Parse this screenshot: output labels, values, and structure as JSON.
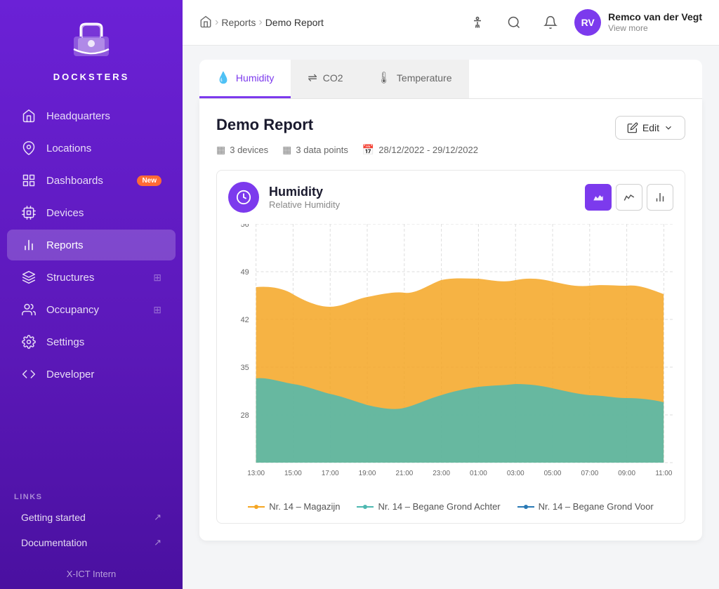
{
  "app": {
    "name": "DOCKSTERS",
    "footer": "X-ICT Intern"
  },
  "sidebar": {
    "nav_items": [
      {
        "id": "headquarters",
        "label": "Headquarters",
        "icon": "home"
      },
      {
        "id": "locations",
        "label": "Locations",
        "icon": "map-pin"
      },
      {
        "id": "dashboards",
        "label": "Dashboards",
        "icon": "grid",
        "badge": "New"
      },
      {
        "id": "devices",
        "label": "Devices",
        "icon": "cpu"
      },
      {
        "id": "reports",
        "label": "Reports",
        "icon": "bar-chart",
        "active": true
      },
      {
        "id": "structures",
        "label": "Structures",
        "icon": "layers",
        "badge_sub": "⊕"
      },
      {
        "id": "occupancy",
        "label": "Occupancy",
        "icon": "users",
        "badge_sub": "⊕"
      },
      {
        "id": "settings",
        "label": "Settings",
        "icon": "settings"
      },
      {
        "id": "developer",
        "label": "Developer",
        "icon": "code"
      }
    ],
    "links_label": "LINKS",
    "links": [
      {
        "id": "getting-started",
        "label": "Getting started"
      },
      {
        "id": "documentation",
        "label": "Documentation"
      }
    ]
  },
  "header": {
    "breadcrumbs": [
      {
        "label": "Home",
        "icon": "home"
      },
      {
        "label": "Reports"
      },
      {
        "label": "Demo Report",
        "active": true
      }
    ],
    "user": {
      "name": "Remco van der Vegt",
      "sub": "View more",
      "initials": "RV"
    }
  },
  "tabs": [
    {
      "id": "humidity",
      "label": "Humidity",
      "active": true
    },
    {
      "id": "co2",
      "label": "CO2"
    },
    {
      "id": "temperature",
      "label": "Temperature"
    }
  ],
  "report": {
    "title": "Demo Report",
    "edit_label": "Edit",
    "devices": "3 devices",
    "data_points": "3 data points",
    "date_range": "28/12/2022 - 29/12/2022"
  },
  "chart": {
    "title": "Humidity",
    "subtitle": "Relative Humidity",
    "y_labels": [
      "56",
      "49",
      "42",
      "35",
      "28"
    ],
    "x_labels": [
      "13:00",
      "15:00",
      "17:00",
      "19:00",
      "21:00",
      "23:00",
      "01:00",
      "03:00",
      "05:00",
      "07:00",
      "09:00",
      "11:00"
    ],
    "view_btns": [
      {
        "id": "area",
        "label": "Area chart",
        "icon": "area",
        "active": true
      },
      {
        "id": "line",
        "label": "Line chart",
        "icon": "line"
      },
      {
        "id": "bar",
        "label": "Bar chart",
        "icon": "bar"
      }
    ],
    "series": [
      {
        "id": "magazijn",
        "color": "#f5a623",
        "label": "Nr. 14 – Magazijn"
      },
      {
        "id": "begane-achter",
        "color": "#4db8b0",
        "label": "Nr. 14 – Begane Grond Achter"
      },
      {
        "id": "begane-voor",
        "color": "#2979b5",
        "label": "Nr. 14 – Begane Grond Voor"
      }
    ]
  }
}
